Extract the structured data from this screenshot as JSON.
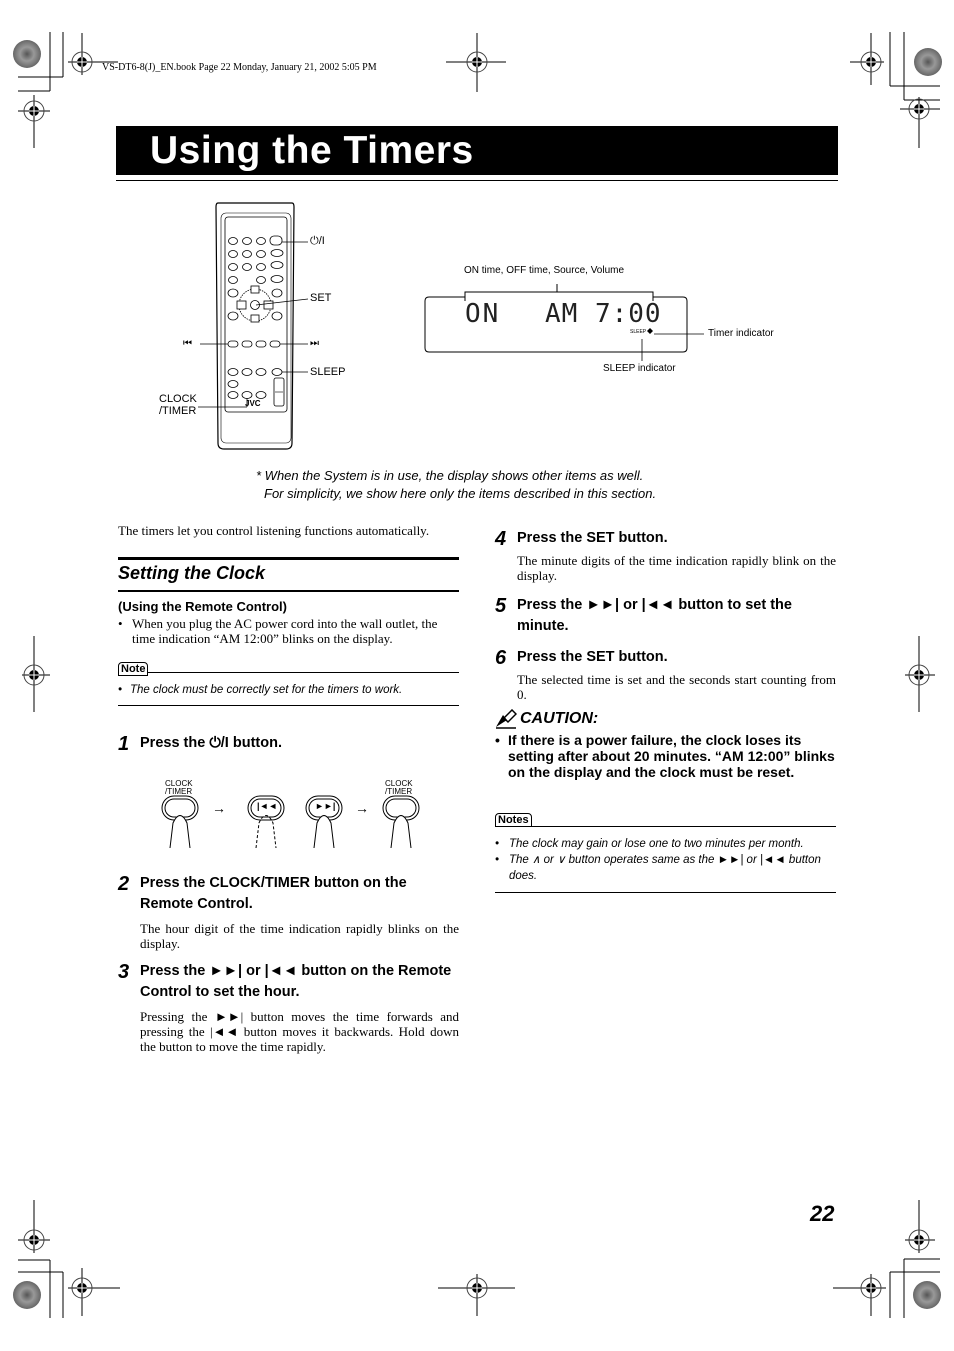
{
  "header": {
    "running_head": "VS-DT6-8(J)_EN.book  Page 22  Monday, January 21, 2002  5:05 PM"
  },
  "page": {
    "title": "Using the Timers",
    "page_number": "22"
  },
  "remote_figure": {
    "brand": "JVC",
    "callouts": {
      "power": "⏻/I",
      "set": "SET",
      "prev": "⏮",
      "next": "⏭",
      "sleep": "SLEEP",
      "clock_timer_line1": "CLOCK",
      "clock_timer_line2": "/TIMER"
    }
  },
  "display_figure": {
    "bracket_label": "ON time, OFF time, Source, Volume",
    "display_text_left": "ON",
    "display_text_right": "AM 7:00",
    "sleep_small": "SLEEP",
    "timer_indicator_label": "Timer indicator",
    "sleep_indicator_label": "SLEEP indicator"
  },
  "footnote": {
    "line1": "* When the System is in use, the display shows other items as well.",
    "line2": "For simplicity, we show here only the items described in this section."
  },
  "left_column": {
    "intro": "The timers let you control listening functions automatically.",
    "section_title": "Setting the Clock",
    "subheading": "(Using the Remote Control)",
    "bullet": "When you plug the AC power cord into the wall outlet, the time indication “AM 12:00” blinks on the display.",
    "note_label": "Note",
    "note_item": "The clock must be correctly set for the timers to work.",
    "steps": [
      {
        "num": "1",
        "title": "Press the ⏻/I button.",
        "body": ""
      },
      {
        "num": "2",
        "title": "Press the CLOCK/TIMER button on the Remote Control.",
        "body": "The hour digit of the time indication rapidly blinks on the display."
      },
      {
        "num": "3",
        "title": "Press the ►►| or |◄◄ button on the Remote Control to set the hour.",
        "body": "Pressing the ►►| button moves the time forwards and pressing the |◄◄ button moves it backwards. Hold down the button to move the time rapidly."
      }
    ],
    "sequence_figure": {
      "label_first_1": "CLOCK",
      "label_first_2": "/TIMER",
      "label_last_1": "CLOCK",
      "label_last_2": "/TIMER",
      "prev_glyph": "|◄◄",
      "next_glyph": "►►|",
      "arrow": "→"
    }
  },
  "right_column": {
    "steps": [
      {
        "num": "4",
        "title": "Press the SET button.",
        "body": "The minute digits of the time indication rapidly blink on the display."
      },
      {
        "num": "5",
        "title": "Press the ►►| or |◄◄ button to set the minute.",
        "body": ""
      },
      {
        "num": "6",
        "title": "Press the SET button.",
        "body": "The selected time is set and the seconds start counting from 0."
      }
    ],
    "caution_title": "CAUTION:",
    "caution_body": "If there is a power failure, the clock loses its setting after about 20 minutes. “AM 12:00” blinks on the display and the clock must be reset.",
    "notes_label": "Notes",
    "notes": [
      "The clock may gain or lose one to two minutes per month.",
      "The ∧ or ∨ button operates same as the ►►| or |◄◄ button does."
    ]
  }
}
